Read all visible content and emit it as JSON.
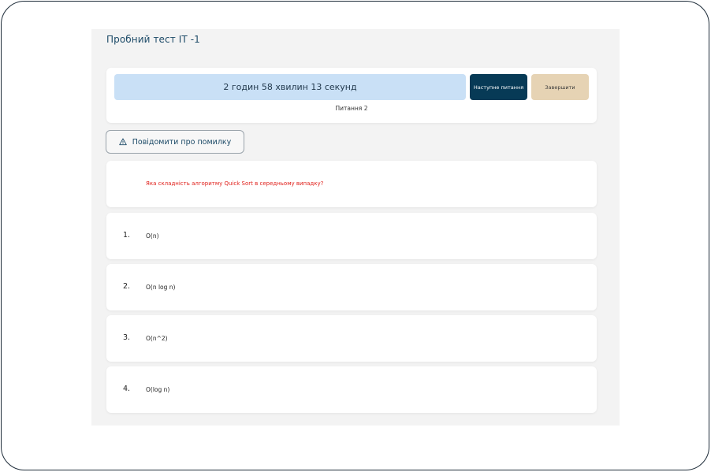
{
  "page": {
    "title": "Пробний тест ІТ -1"
  },
  "timer": {
    "remaining": "2 годин 58 хвилин 13 секунд",
    "next_label": "Наступне питання",
    "finish_label": "Завершити",
    "question_counter": "Питання 2"
  },
  "report": {
    "label": "Повідомити про помилку",
    "icon": "warning-icon"
  },
  "question": {
    "text": "Яка складність алгоритму Quick Sort в середньому випадку?"
  },
  "answers": [
    {
      "num": "1.",
      "text": "O(n)"
    },
    {
      "num": "2.",
      "text": " O(n log n)"
    },
    {
      "num": "3.",
      "text": "O(n^2)"
    },
    {
      "num": "4.",
      "text": "O(log n)"
    }
  ],
  "colors": {
    "accent": "#073a56",
    "timer_bg": "#c9e0f6",
    "finish_bg": "#e6d3b4",
    "question_text": "#e0211c",
    "title": "#1c4a67"
  }
}
